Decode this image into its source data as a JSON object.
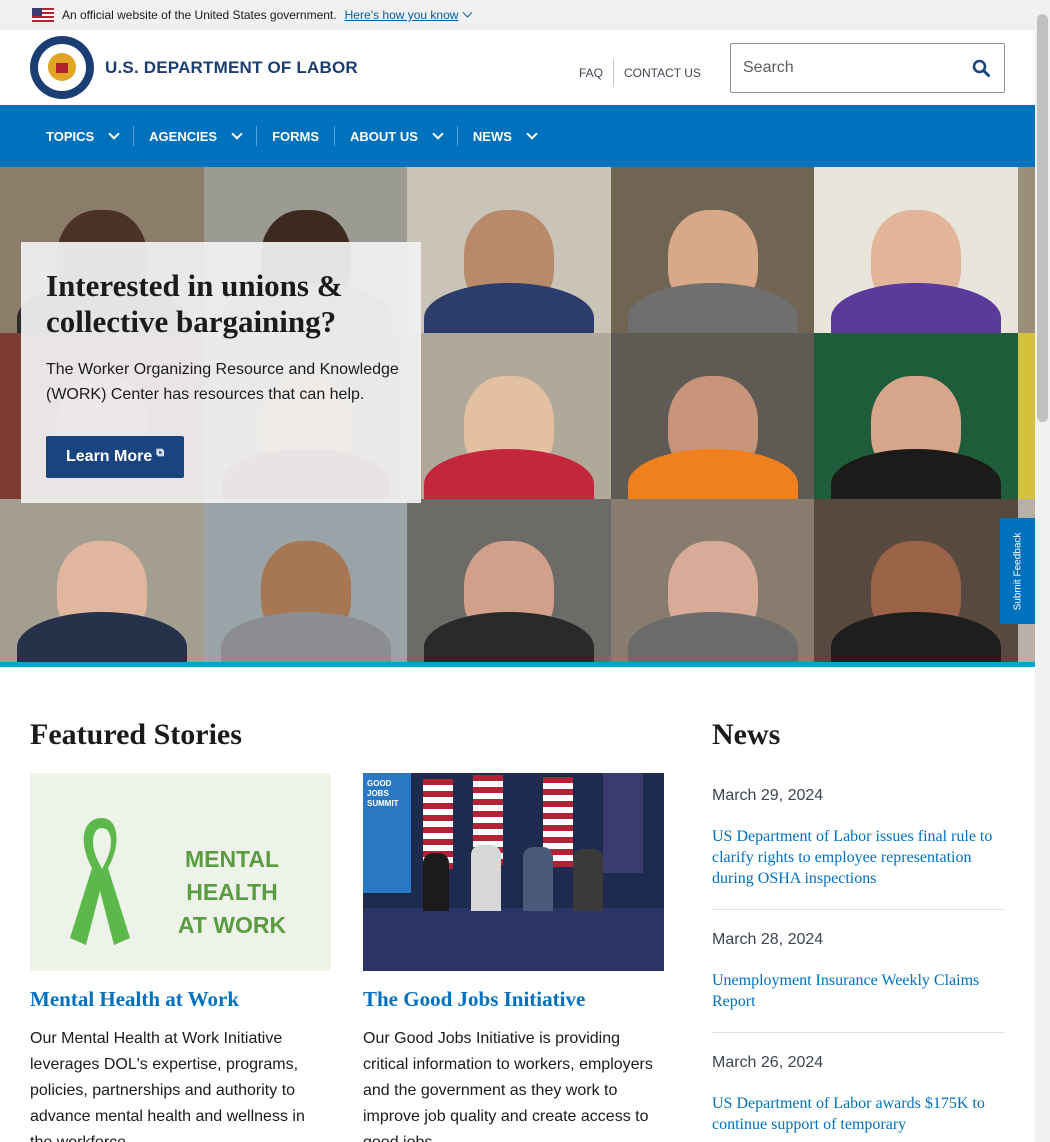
{
  "gov_banner": {
    "text": "An official website of the United States government.",
    "link": "Here’s how you know"
  },
  "header": {
    "site_title": "U.S. DEPARTMENT OF LABOR",
    "faq": "FAQ",
    "contact": "CONTACT US",
    "search_placeholder": "Search"
  },
  "nav": {
    "items": [
      {
        "label": "TOPICS"
      },
      {
        "label": "AGENCIES"
      },
      {
        "label": "FORMS"
      },
      {
        "label": "ABOUT US"
      },
      {
        "label": "NEWS"
      }
    ]
  },
  "hero": {
    "title": "Interested in unions & collective bargaining?",
    "body": "The Worker Organizing Resource and Knowledge (WORK) Center has resources that can help.",
    "button": "Learn More",
    "ext_icon": "external-link-icon"
  },
  "feedback": "Submit Feedback",
  "featured": {
    "heading": "Featured Stories",
    "cards": [
      {
        "title": "Mental Health at Work",
        "text": "Our Mental Health at Work Initiative leverages DOL's expertise, programs, policies, partnerships and authority to advance mental health and wellness in the workforce.",
        "image_text_1": "MENTAL HEALTH",
        "image_text_2": "AT WORK"
      },
      {
        "title": "The Good Jobs Initiative",
        "text": "Our Good Jobs Initiative is providing critical information to workers, employers and the government as they work to improve job quality and create access to good jobs.",
        "image_text_1": "GOOD",
        "image_text_2": "JOBS SUMMIT"
      }
    ]
  },
  "news": {
    "heading": "News",
    "items": [
      {
        "date": "March 29, 2024",
        "title": "US Department of Labor issues final rule to clarify rights to employee representation during OSHA inspections"
      },
      {
        "date": "March 28, 2024",
        "title": "Unemployment Insurance Weekly Claims Report"
      },
      {
        "date": "March 26, 2024",
        "title": "US Department of Labor awards $175K to continue support of temporary"
      }
    ]
  },
  "colors": {
    "nav_blue": "#0071bc",
    "button_navy": "#1a4480",
    "accent_cyan": "#00a6d2",
    "title_navy": "#1a3e72"
  }
}
